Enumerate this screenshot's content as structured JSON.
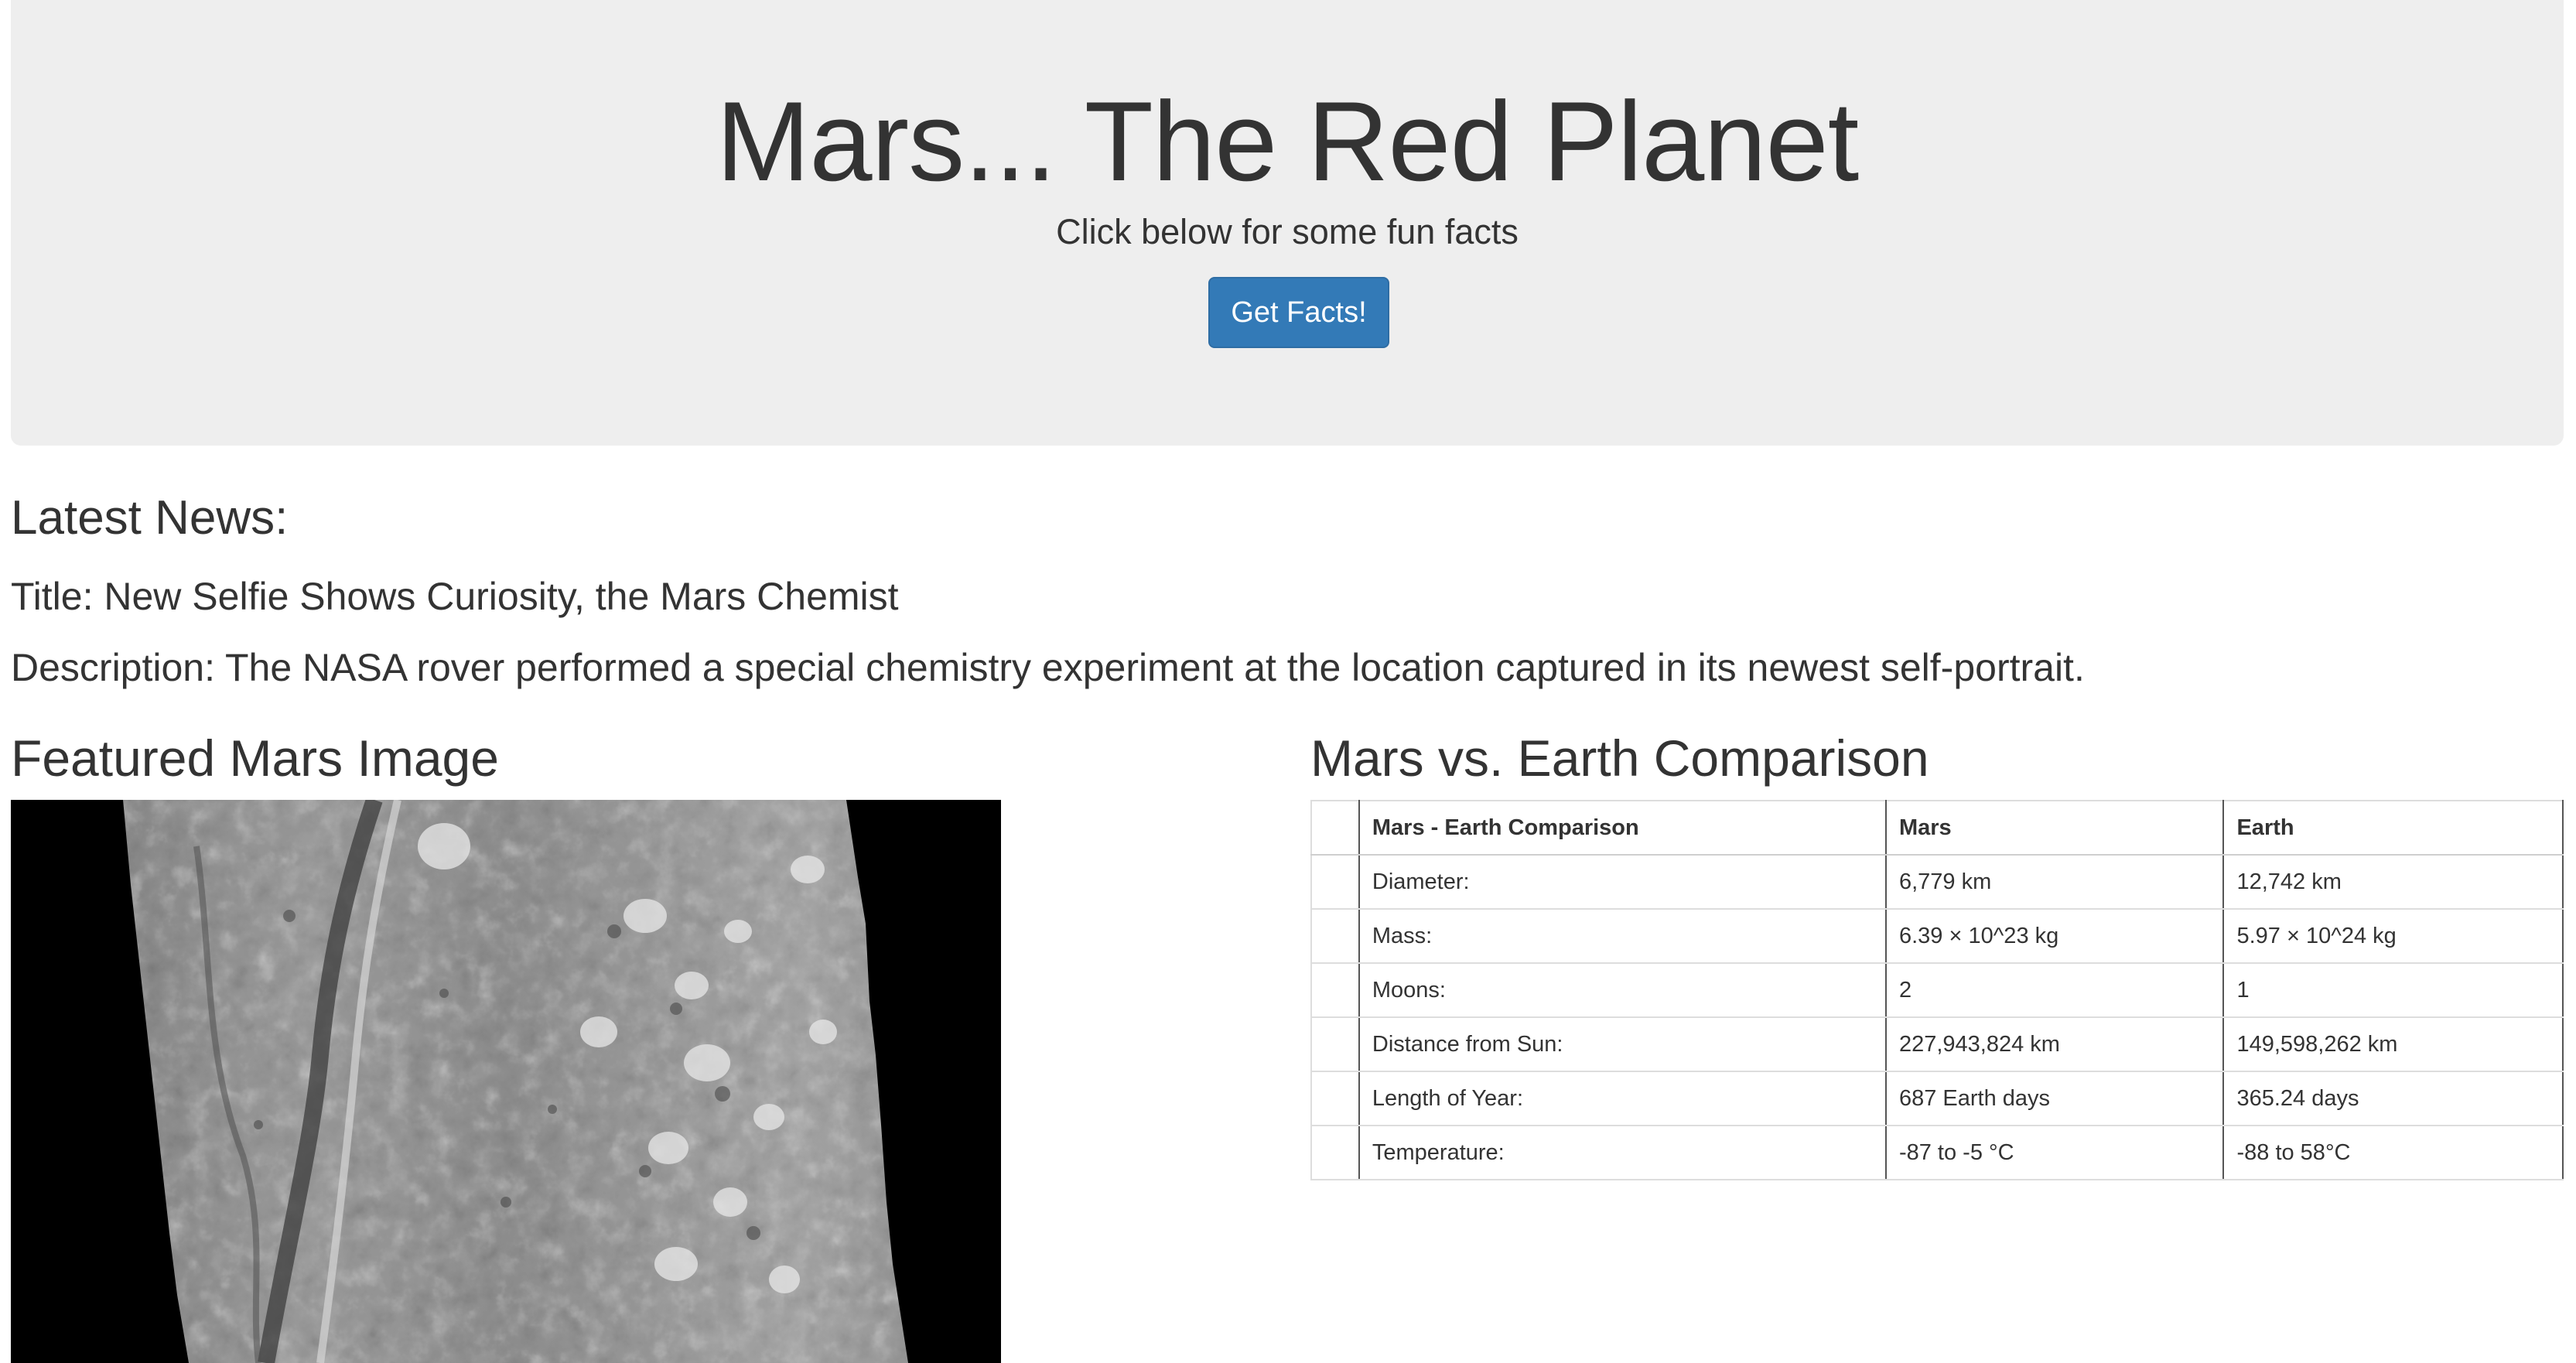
{
  "jumbotron": {
    "title": "Mars... The Red Planet",
    "subtitle": "Click below for some fun facts",
    "button_label": "Get Facts!"
  },
  "news": {
    "heading": "Latest News:",
    "title": "Title: New Selfie Shows Curiosity, the Mars Chemist",
    "description": "Description: The NASA rover performed a special chemistry experiment at the location captured in its newest self-portrait."
  },
  "featured_image": {
    "heading": "Featured Mars Image"
  },
  "comparison": {
    "heading": "Mars vs. Earth Comparison",
    "columns": [
      "",
      "Mars - Earth Comparison",
      "Mars",
      "Earth"
    ],
    "rows": [
      [
        "",
        "Diameter:",
        "6,779 km",
        "12,742 km"
      ],
      [
        "",
        "Mass:",
        "6.39 × 10^23 kg",
        "5.97 × 10^24 kg"
      ],
      [
        "",
        "Moons:",
        "2",
        "1"
      ],
      [
        "",
        "Distance from Sun:",
        "227,943,824 km",
        "149,598,262 km"
      ],
      [
        "",
        "Length of Year:",
        "687 Earth days",
        "365.24 days"
      ],
      [
        "",
        "Temperature:",
        "-87 to -5 °C",
        "-88 to 58°C"
      ]
    ]
  },
  "colors": {
    "jumbotron_bg": "#eeeeee",
    "button_bg": "#337ab7",
    "text": "#333333"
  }
}
